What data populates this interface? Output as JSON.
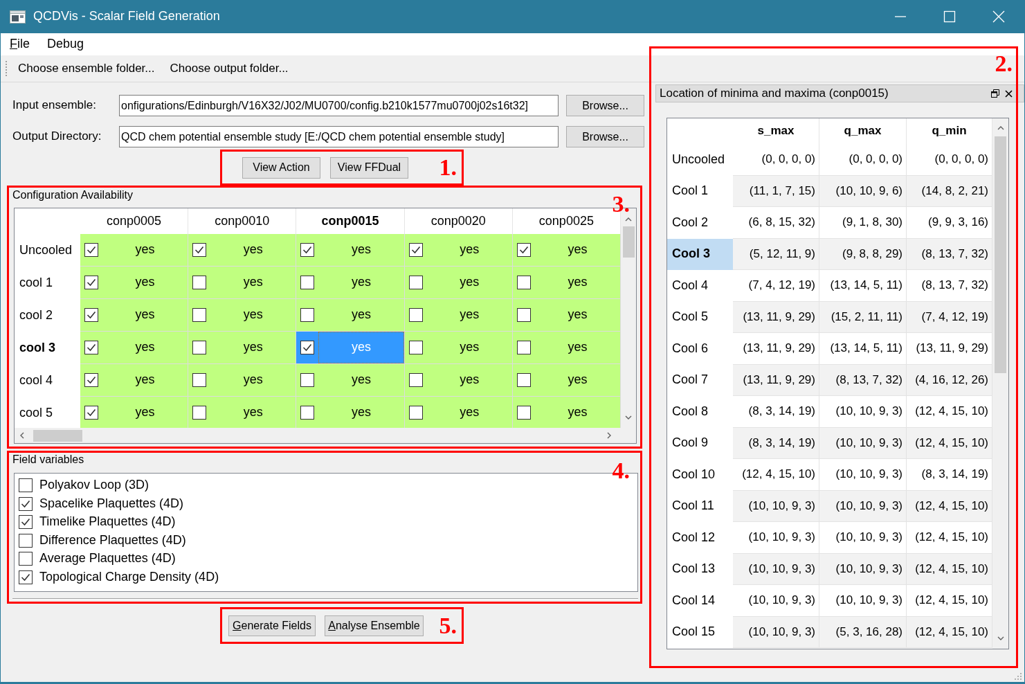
{
  "window": {
    "title": "QCDVis - Scalar Field Generation"
  },
  "menu": [
    {
      "label": "File",
      "mnemonic": true
    },
    {
      "label": "Debug",
      "mnemonic": false
    }
  ],
  "toolbar": [
    "Choose ensemble folder...",
    "Choose output folder..."
  ],
  "paths": [
    {
      "label": "Input ensemble:",
      "value": "onfigurations/Edinburgh/V16X32/J02/MU0700/config.b210k1577mu0700j02s16t32]",
      "button": "Browse..."
    },
    {
      "label": "Output Directory:",
      "value": "QCD chem potential ensemble study [E:/QCD chem potential ensemble study]",
      "button": "Browse..."
    }
  ],
  "view_buttons": {
    "annotation": "1.",
    "buttons": [
      "View Action",
      "View FFDual"
    ]
  },
  "configurations": {
    "annotation": "3.",
    "title": "Configuration Availability",
    "columns": [
      {
        "label": "conp0005",
        "current": false
      },
      {
        "label": "conp0010",
        "current": false
      },
      {
        "label": "conp0015",
        "current": true
      },
      {
        "label": "conp0020",
        "current": false
      },
      {
        "label": "conp0025",
        "current": false
      }
    ],
    "rows": [
      {
        "label": "Uncooled",
        "current": false,
        "cells": [
          {
            "checked": true,
            "text": "yes",
            "selected": false
          },
          {
            "checked": true,
            "text": "yes",
            "selected": false
          },
          {
            "checked": true,
            "text": "yes",
            "selected": false
          },
          {
            "checked": true,
            "text": "yes",
            "selected": false
          },
          {
            "checked": true,
            "text": "yes",
            "selected": false
          }
        ]
      },
      {
        "label": "cool 1",
        "current": false,
        "cells": [
          {
            "checked": true,
            "text": "yes",
            "selected": false
          },
          {
            "checked": false,
            "text": "yes",
            "selected": false
          },
          {
            "checked": false,
            "text": "yes",
            "selected": false
          },
          {
            "checked": false,
            "text": "yes",
            "selected": false
          },
          {
            "checked": false,
            "text": "yes",
            "selected": false
          }
        ]
      },
      {
        "label": "cool 2",
        "current": false,
        "cells": [
          {
            "checked": true,
            "text": "yes",
            "selected": false
          },
          {
            "checked": false,
            "text": "yes",
            "selected": false
          },
          {
            "checked": false,
            "text": "yes",
            "selected": false
          },
          {
            "checked": false,
            "text": "yes",
            "selected": false
          },
          {
            "checked": false,
            "text": "yes",
            "selected": false
          }
        ]
      },
      {
        "label": "cool 3",
        "current": true,
        "cells": [
          {
            "checked": true,
            "text": "yes",
            "selected": false
          },
          {
            "checked": false,
            "text": "yes",
            "selected": false
          },
          {
            "checked": true,
            "text": "yes",
            "selected": true
          },
          {
            "checked": false,
            "text": "yes",
            "selected": false
          },
          {
            "checked": false,
            "text": "yes",
            "selected": false
          }
        ]
      },
      {
        "label": "cool 4",
        "current": false,
        "cells": [
          {
            "checked": true,
            "text": "yes",
            "selected": false
          },
          {
            "checked": false,
            "text": "yes",
            "selected": false
          },
          {
            "checked": false,
            "text": "yes",
            "selected": false
          },
          {
            "checked": false,
            "text": "yes",
            "selected": false
          },
          {
            "checked": false,
            "text": "yes",
            "selected": false
          }
        ]
      },
      {
        "label": "cool 5",
        "current": false,
        "cells": [
          {
            "checked": true,
            "text": "yes",
            "selected": false
          },
          {
            "checked": false,
            "text": "yes",
            "selected": false
          },
          {
            "checked": false,
            "text": "yes",
            "selected": false
          },
          {
            "checked": false,
            "text": "yes",
            "selected": false
          },
          {
            "checked": false,
            "text": "yes",
            "selected": false
          }
        ]
      }
    ]
  },
  "field_variables": {
    "annotation": "4.",
    "title": "Field variables",
    "items": [
      {
        "label": "Polyakov Loop (3D)",
        "checked": false
      },
      {
        "label": "Spacelike Plaquettes (4D)",
        "checked": true
      },
      {
        "label": "Timelike Plaquettes (4D)",
        "checked": true
      },
      {
        "label": "Difference Plaquettes (4D)",
        "checked": false
      },
      {
        "label": "Average Plaquettes (4D)",
        "checked": false
      },
      {
        "label": "Topological Charge Density (4D)",
        "checked": true
      }
    ]
  },
  "action_buttons": {
    "annotation": "5.",
    "buttons": [
      {
        "label": "Generate Fields",
        "mnemonic": true
      },
      {
        "label": "Analyse Ensemble",
        "mnemonic": true
      }
    ]
  },
  "dock": {
    "annotation": "2.",
    "title": "Location of minima and maxima (conp0015)",
    "columns": [
      "s_max",
      "q_max",
      "q_min"
    ],
    "rows": [
      {
        "label": "Uncooled",
        "selected": false,
        "values": [
          "(0, 0, 0, 0)",
          "(0, 0, 0, 0)",
          "(0, 0, 0, 0)"
        ]
      },
      {
        "label": "Cool 1",
        "selected": false,
        "values": [
          "(11, 1, 7, 15)",
          "(10, 10, 9, 6)",
          "(14, 8, 2, 21)"
        ]
      },
      {
        "label": "Cool 2",
        "selected": false,
        "values": [
          "(6, 8, 15, 32)",
          "(9, 1, 8, 30)",
          "(9, 9, 3, 16)"
        ]
      },
      {
        "label": "Cool 3",
        "selected": true,
        "values": [
          "(5, 12, 11, 9)",
          "(9, 8, 8, 29)",
          "(8, 13, 7, 32)"
        ]
      },
      {
        "label": "Cool 4",
        "selected": false,
        "values": [
          "(7, 4, 12, 19)",
          "(13, 14, 5, 11)",
          "(8, 13, 7, 32)"
        ]
      },
      {
        "label": "Cool 5",
        "selected": false,
        "values": [
          "(13, 11, 9, 29)",
          "(15, 2, 11, 11)",
          "(7, 4, 12, 19)"
        ]
      },
      {
        "label": "Cool 6",
        "selected": false,
        "values": [
          "(13, 11, 9, 29)",
          "(13, 14, 5, 11)",
          "(13, 11, 9, 29)"
        ]
      },
      {
        "label": "Cool 7",
        "selected": false,
        "values": [
          "(13, 11, 9, 29)",
          "(8, 13, 7, 32)",
          "(4, 16, 12, 26)"
        ]
      },
      {
        "label": "Cool 8",
        "selected": false,
        "values": [
          "(8, 3, 14, 19)",
          "(10, 10, 9, 3)",
          "(12, 4, 15, 10)"
        ]
      },
      {
        "label": "Cool 9",
        "selected": false,
        "values": [
          "(8, 3, 14, 19)",
          "(10, 10, 9, 3)",
          "(12, 4, 15, 10)"
        ]
      },
      {
        "label": "Cool 10",
        "selected": false,
        "values": [
          "(12, 4, 15, 10)",
          "(10, 10, 9, 3)",
          "(8, 3, 14, 19)"
        ]
      },
      {
        "label": "Cool 11",
        "selected": false,
        "values": [
          "(10, 10, 9, 3)",
          "(10, 10, 9, 3)",
          "(12, 4, 15, 10)"
        ]
      },
      {
        "label": "Cool 12",
        "selected": false,
        "values": [
          "(10, 10, 9, 3)",
          "(10, 10, 9, 3)",
          "(12, 4, 15, 10)"
        ]
      },
      {
        "label": "Cool 13",
        "selected": false,
        "values": [
          "(10, 10, 9, 3)",
          "(10, 10, 9, 3)",
          "(12, 4, 15, 10)"
        ]
      },
      {
        "label": "Cool 14",
        "selected": false,
        "values": [
          "(10, 10, 9, 3)",
          "(10, 10, 9, 3)",
          "(12, 4, 15, 10)"
        ]
      },
      {
        "label": "Cool 15",
        "selected": false,
        "values": [
          "(10, 10, 9, 3)",
          "(5, 3, 16, 28)",
          "(12, 4, 15, 10)"
        ]
      }
    ]
  }
}
